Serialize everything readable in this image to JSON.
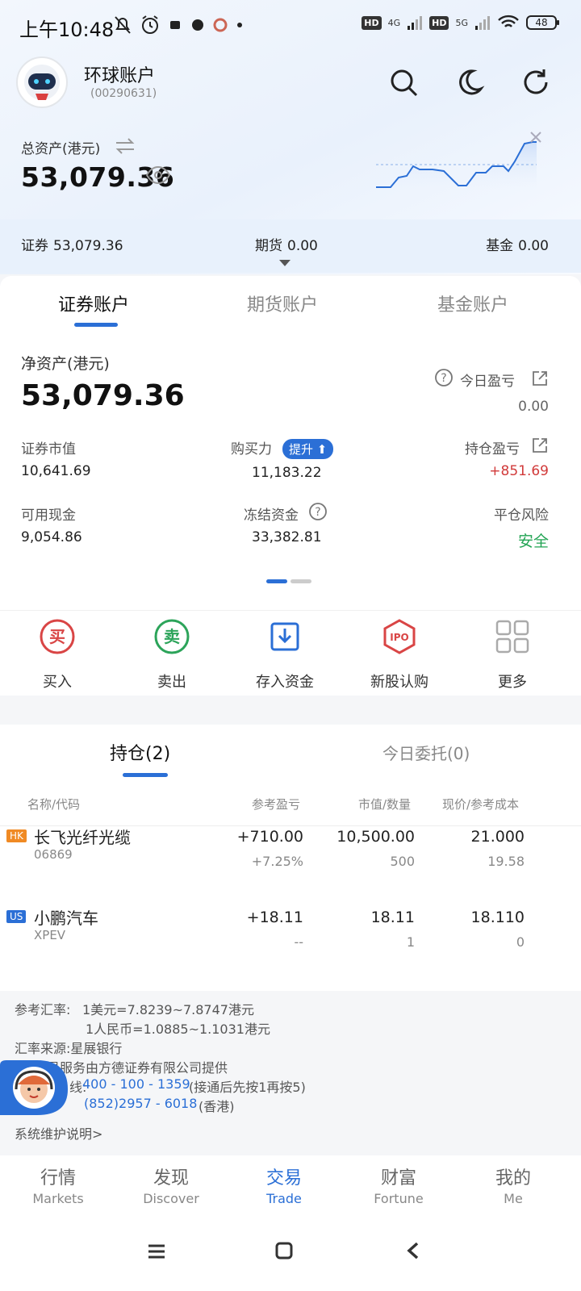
{
  "status": {
    "time": "上午10:48",
    "net1": "4G",
    "net2": "5G",
    "hd": "HD",
    "battery": "48"
  },
  "header": {
    "account_name": "环球账户",
    "account_id": "(00290631)",
    "icons": [
      "search-icon",
      "moon-icon",
      "refresh-icon"
    ]
  },
  "totals": {
    "label": "总资产(港元)",
    "value": "53,079.36"
  },
  "summary": {
    "securities_label": "证券",
    "securities_value": "53,079.36",
    "futures_label": "期货",
    "futures_value": "0.00",
    "fund_label": "基金",
    "fund_value": "0.00"
  },
  "tabs": {
    "t1": "证券账户",
    "t2": "期货账户",
    "t3": "基金账户"
  },
  "account": {
    "net_label": "净资产(港元)",
    "net_value": "53,079.36",
    "today_pl_label": "今日盈亏",
    "today_pl_value": "0.00",
    "mv_label": "证券市值",
    "mv_value": "10,641.69",
    "bp_label": "购买力",
    "bp_boost": "提升",
    "bp_value": "11,183.22",
    "hold_pl_label": "持仓盈亏",
    "hold_pl_value": "+851.69",
    "cash_label": "可用现金",
    "cash_value": "9,054.86",
    "frozen_label": "冻结资金",
    "frozen_value": "33,382.81",
    "risk_label": "平仓风险",
    "risk_value": "安全"
  },
  "actions": {
    "buy": "买入",
    "sell": "卖出",
    "deposit": "存入资金",
    "ipo": "新股认购",
    "more": "更多",
    "buy_glyph": "买",
    "sell_glyph": "卖",
    "ipo_glyph": "IPO"
  },
  "positions": {
    "tab_hold": "持仓(2)",
    "tab_orders": "今日委托(0)",
    "col_name": "名称/代码",
    "col_pl": "参考盈亏",
    "col_mv": "市值/数量",
    "col_price": "现价/参考成本",
    "rows": [
      {
        "market": "HK",
        "name": "长飞光纤光缆",
        "code": "06869",
        "pl": "+710.00",
        "pl_pct": "+7.25%",
        "mv": "10,500.00",
        "qty": "500",
        "price": "21.000",
        "cost": "19.58"
      },
      {
        "market": "US",
        "name": "小鹏汽车",
        "code": "XPEV",
        "pl": "+18.11",
        "pl_pct": "--",
        "mv": "18.11",
        "qty": "1",
        "price": "18.110",
        "cost": "0"
      }
    ]
  },
  "footer": {
    "rate_label": "参考汇率:",
    "rate1": "1美元=7.8239~7.8747港元",
    "rate2": "1人民币=1.0885~1.1031港元",
    "source": "汇率来源:星展银行",
    "service": "易服务由方德证券有限公司提供",
    "phone_label": "线:",
    "phone1": "400 - 100 - 1359",
    "phone1_note": "(接通后先按1再按5)",
    "phone2": "(852)2957 - 6018",
    "phone2_note": "(香港)",
    "maintenance": "系统维护说明>"
  },
  "nav": [
    {
      "zh": "行情",
      "en": "Markets"
    },
    {
      "zh": "发现",
      "en": "Discover"
    },
    {
      "zh": "交易",
      "en": "Trade"
    },
    {
      "zh": "财富",
      "en": "Fortune"
    },
    {
      "zh": "我的",
      "en": "Me"
    }
  ],
  "colors": {
    "accent": "#2b6fd6",
    "up": "#d13a3a",
    "safe": "#23a454",
    "hk_tag": "#f08a24",
    "us_tag": "#2b6fd6"
  }
}
